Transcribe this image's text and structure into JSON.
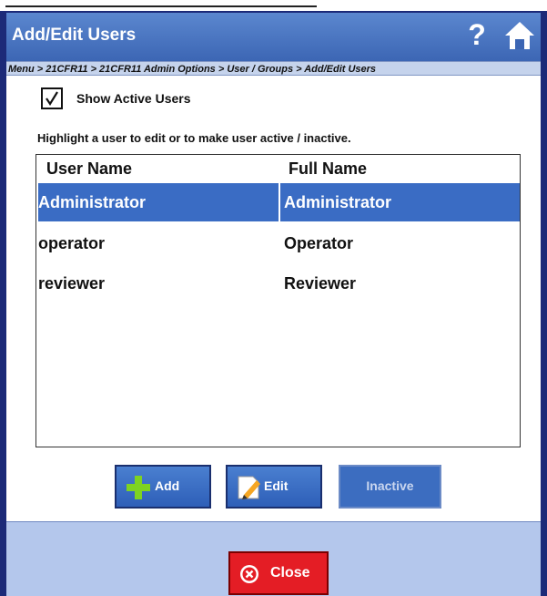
{
  "window": {
    "title": "Add/Edit Users"
  },
  "header_icons": {
    "help": "?",
    "home": "home-icon"
  },
  "breadcrumb": "Menu > 21CFR11 > 21CFR11 Admin Options > User / Groups > Add/Edit Users",
  "show_active": {
    "label": "Show Active Users",
    "checked": true
  },
  "instruction": "Highlight a user to edit or to make user active / inactive.",
  "table": {
    "columns": [
      "User Name",
      "Full Name"
    ],
    "rows": [
      {
        "user": "Administrator",
        "full": "Administrator",
        "selected": true
      },
      {
        "user": "operator",
        "full": "Operator",
        "selected": false
      },
      {
        "user": "reviewer",
        "full": "Reviewer",
        "selected": false
      }
    ]
  },
  "buttons": {
    "add": "Add",
    "edit": "Edit",
    "inactive": "Inactive",
    "close": "Close"
  },
  "colors": {
    "title_bar": "#4a77c2",
    "selection": "#3a6cc4",
    "footer": "#b4c7ec",
    "close": "#e41d25"
  }
}
